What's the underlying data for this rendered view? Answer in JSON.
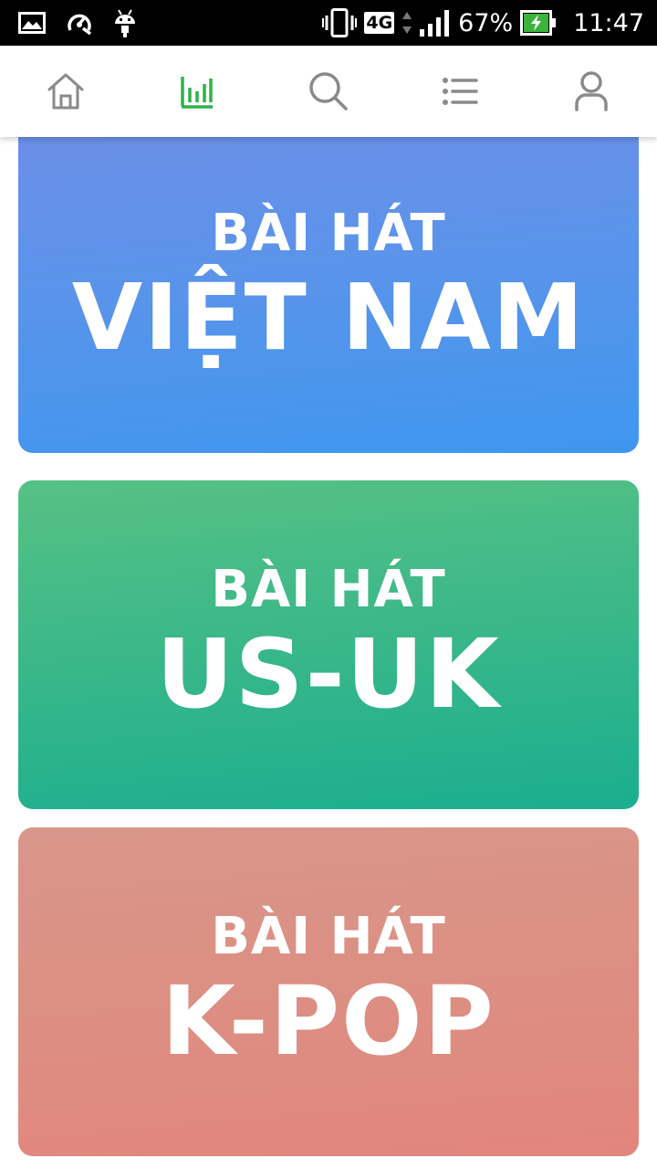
{
  "status_bar": {
    "network": "4G",
    "battery_percent": "67%",
    "time": "11:47",
    "icons": [
      "gallery-icon",
      "speed-icon",
      "android-icon",
      "vibrate-icon",
      "signal-icon",
      "battery-charging-icon"
    ]
  },
  "tabs": [
    {
      "name": "home",
      "icon": "home-icon",
      "active": false
    },
    {
      "name": "charts",
      "icon": "bar-chart-icon",
      "active": true
    },
    {
      "name": "search",
      "icon": "search-icon",
      "active": false
    },
    {
      "name": "list",
      "icon": "list-icon",
      "active": false
    },
    {
      "name": "profile",
      "icon": "user-icon",
      "active": false
    }
  ],
  "colors": {
    "active_tab": "#2db34a",
    "inactive_tab": "#8a8a8a",
    "card_vietnam": "#5592ec",
    "card_usuk": "#2fb58b",
    "card_kpop": "#df8c82"
  },
  "cards": [
    {
      "line1": "BÀI HÁT",
      "line2": "VIỆT NAM"
    },
    {
      "line1": "BÀI HÁT",
      "line2": "US-UK"
    },
    {
      "line1": "BÀI HÁT",
      "line2": "K-POP"
    }
  ]
}
